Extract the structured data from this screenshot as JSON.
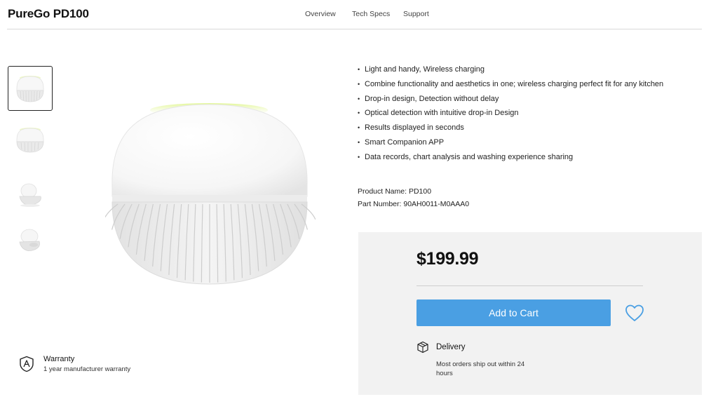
{
  "header": {
    "brand": "PureGo PD100",
    "nav": [
      "Overview",
      "Tech Specs",
      "Support"
    ]
  },
  "gallery": {
    "thumbnails": [
      "product-front",
      "product-front-small",
      "product-side",
      "product-angle"
    ],
    "active_index": 0
  },
  "features": [
    "Light and handy, Wireless charging",
    "Combine functionality and aesthetics in one; wireless charging perfect fit for any kitchen",
    "Drop-in design, Detection without delay",
    "Optical detection with intuitive drop-in Design",
    "Results displayed in seconds",
    "Smart Companion APP",
    "Data records, chart analysis and washing experience sharing"
  ],
  "product": {
    "name_line": "Product Name: PD100",
    "part_line": "Part Number: 90AH0011-M0AAA0"
  },
  "buy": {
    "price": "$199.99",
    "add_to_cart": "Add to Cart",
    "wishlist_icon": "heart-icon",
    "delivery_title": "Delivery",
    "delivery_text": "Most orders ship out within 24 hours"
  },
  "warranty": {
    "title": "Warranty",
    "text": "1 year manufacturer warranty"
  },
  "colors": {
    "accent": "#4a9fe3",
    "buybox_bg": "#f2f2f2",
    "glow": "#e4f5a0"
  }
}
